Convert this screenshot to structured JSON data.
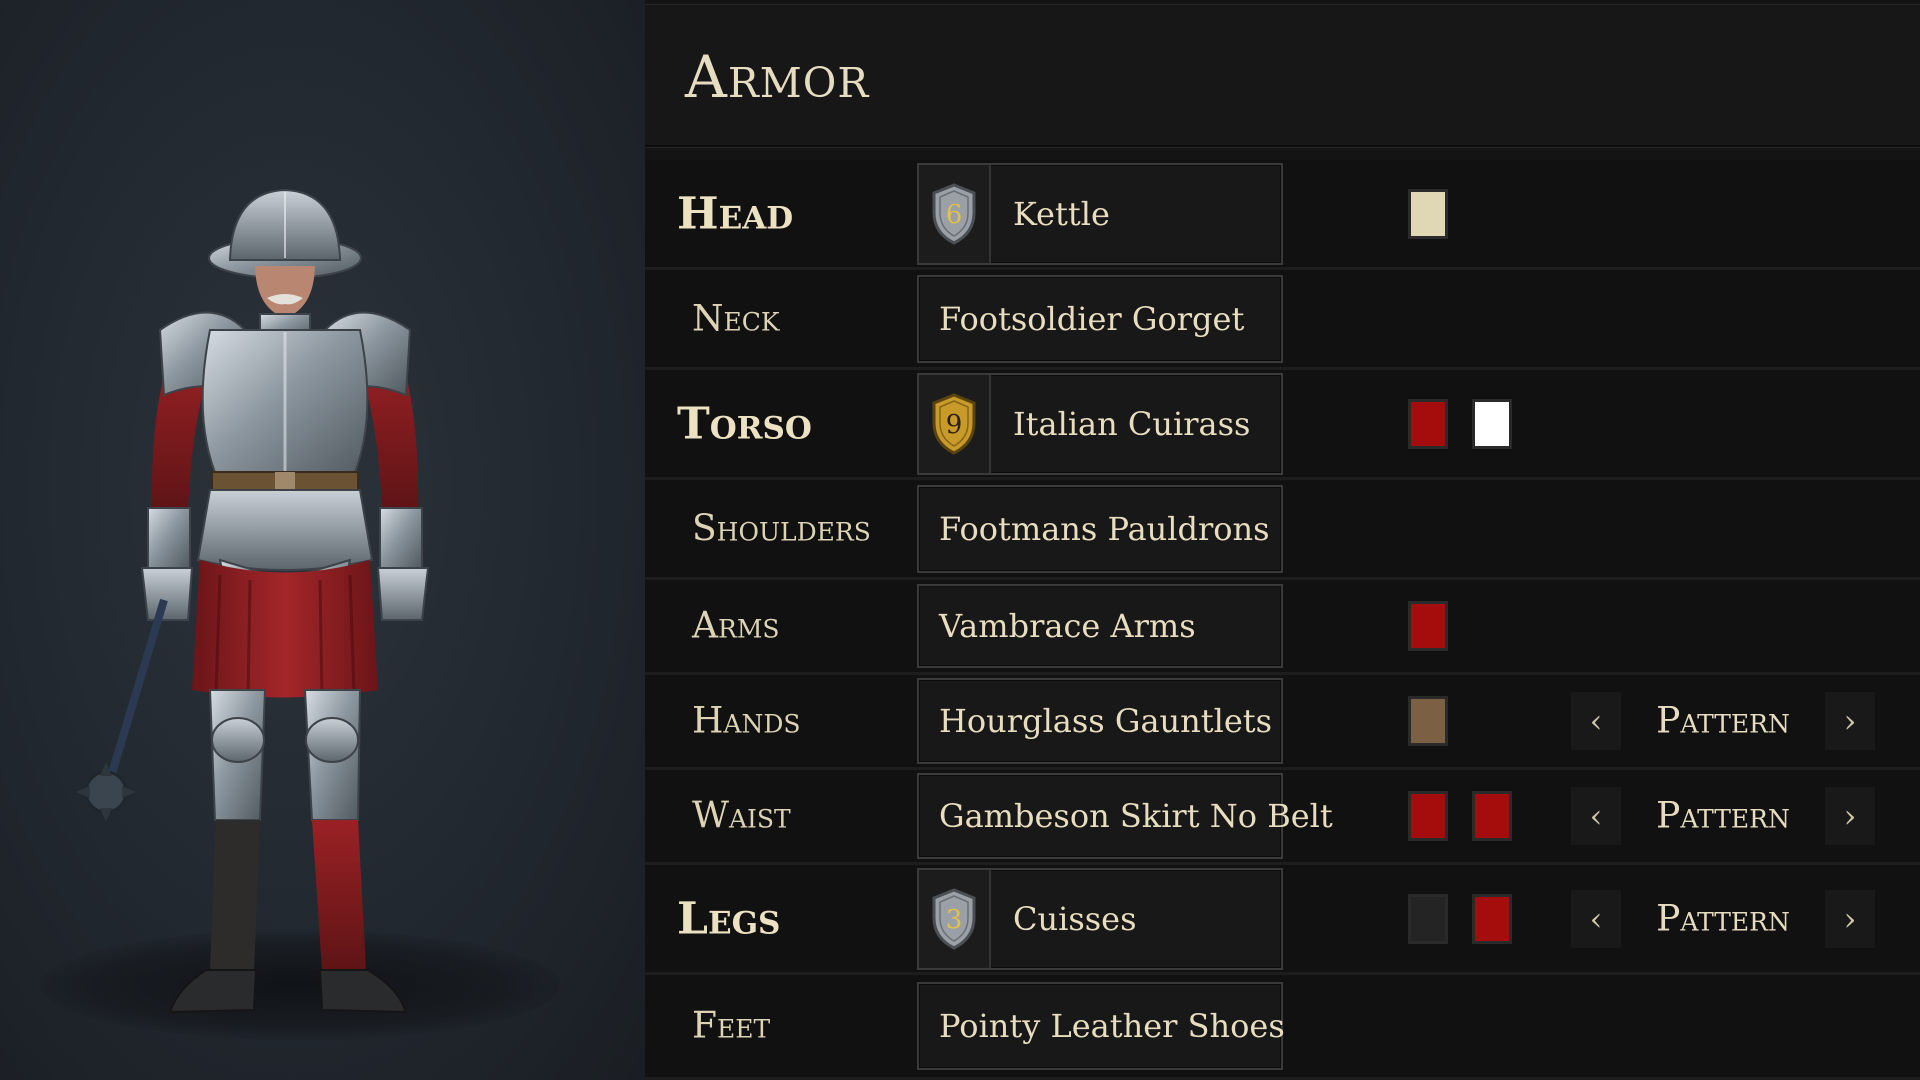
{
  "panel": {
    "title": "Armor"
  },
  "slots": [
    {
      "key": "head",
      "label": "Head",
      "major": true,
      "item": "Kettle",
      "tier": "6",
      "tier_style": "silver",
      "colors": [
        "#e0d7b5"
      ],
      "pattern": null
    },
    {
      "key": "neck",
      "label": "Neck",
      "major": false,
      "item": "Footsoldier Gorget",
      "tier": null,
      "colors": [],
      "pattern": null
    },
    {
      "key": "torso",
      "label": "Torso",
      "major": true,
      "item": "Italian Cuirass",
      "tier": "9",
      "tier_style": "gold",
      "colors": [
        "#a50d0d",
        "#ffffff"
      ],
      "pattern": null
    },
    {
      "key": "shoulders",
      "label": "Shoulders",
      "major": false,
      "item": "Footmans Pauldrons",
      "tier": null,
      "colors": [],
      "pattern": null
    },
    {
      "key": "arms",
      "label": "Arms",
      "major": false,
      "item": "Vambrace Arms",
      "tier": null,
      "colors": [
        "#a50d0d"
      ],
      "pattern": null
    },
    {
      "key": "hands",
      "label": "Hands",
      "major": false,
      "item": "Hourglass Gauntlets",
      "tier": null,
      "colors": [
        "#7b6043"
      ],
      "pattern": "Pattern"
    },
    {
      "key": "waist",
      "label": "Waist",
      "major": false,
      "item": "Gambeson Skirt No Belt",
      "tier": null,
      "colors": [
        "#a50d0d",
        "#a50d0d"
      ],
      "pattern": "Pattern"
    },
    {
      "key": "legs",
      "label": "Legs",
      "major": true,
      "item": "Cuisses",
      "tier": "3",
      "tier_style": "silver",
      "colors": [
        "#242424",
        "#a50d0d"
      ],
      "pattern": "Pattern"
    },
    {
      "key": "feet",
      "label": "Feet",
      "major": false,
      "item": "Pointy Leather Shoes",
      "tier": null,
      "colors": [],
      "pattern": null
    }
  ],
  "icons": {
    "pattern_prev": "‹",
    "pattern_next": "›"
  },
  "theme": {
    "text": "#e6dcc0",
    "panel_bg": "#141414",
    "row_bg": "#111111",
    "accent_red": "#a50d0d",
    "shield_silver": "#9aa0a6",
    "shield_gold": "#c79a2a"
  }
}
